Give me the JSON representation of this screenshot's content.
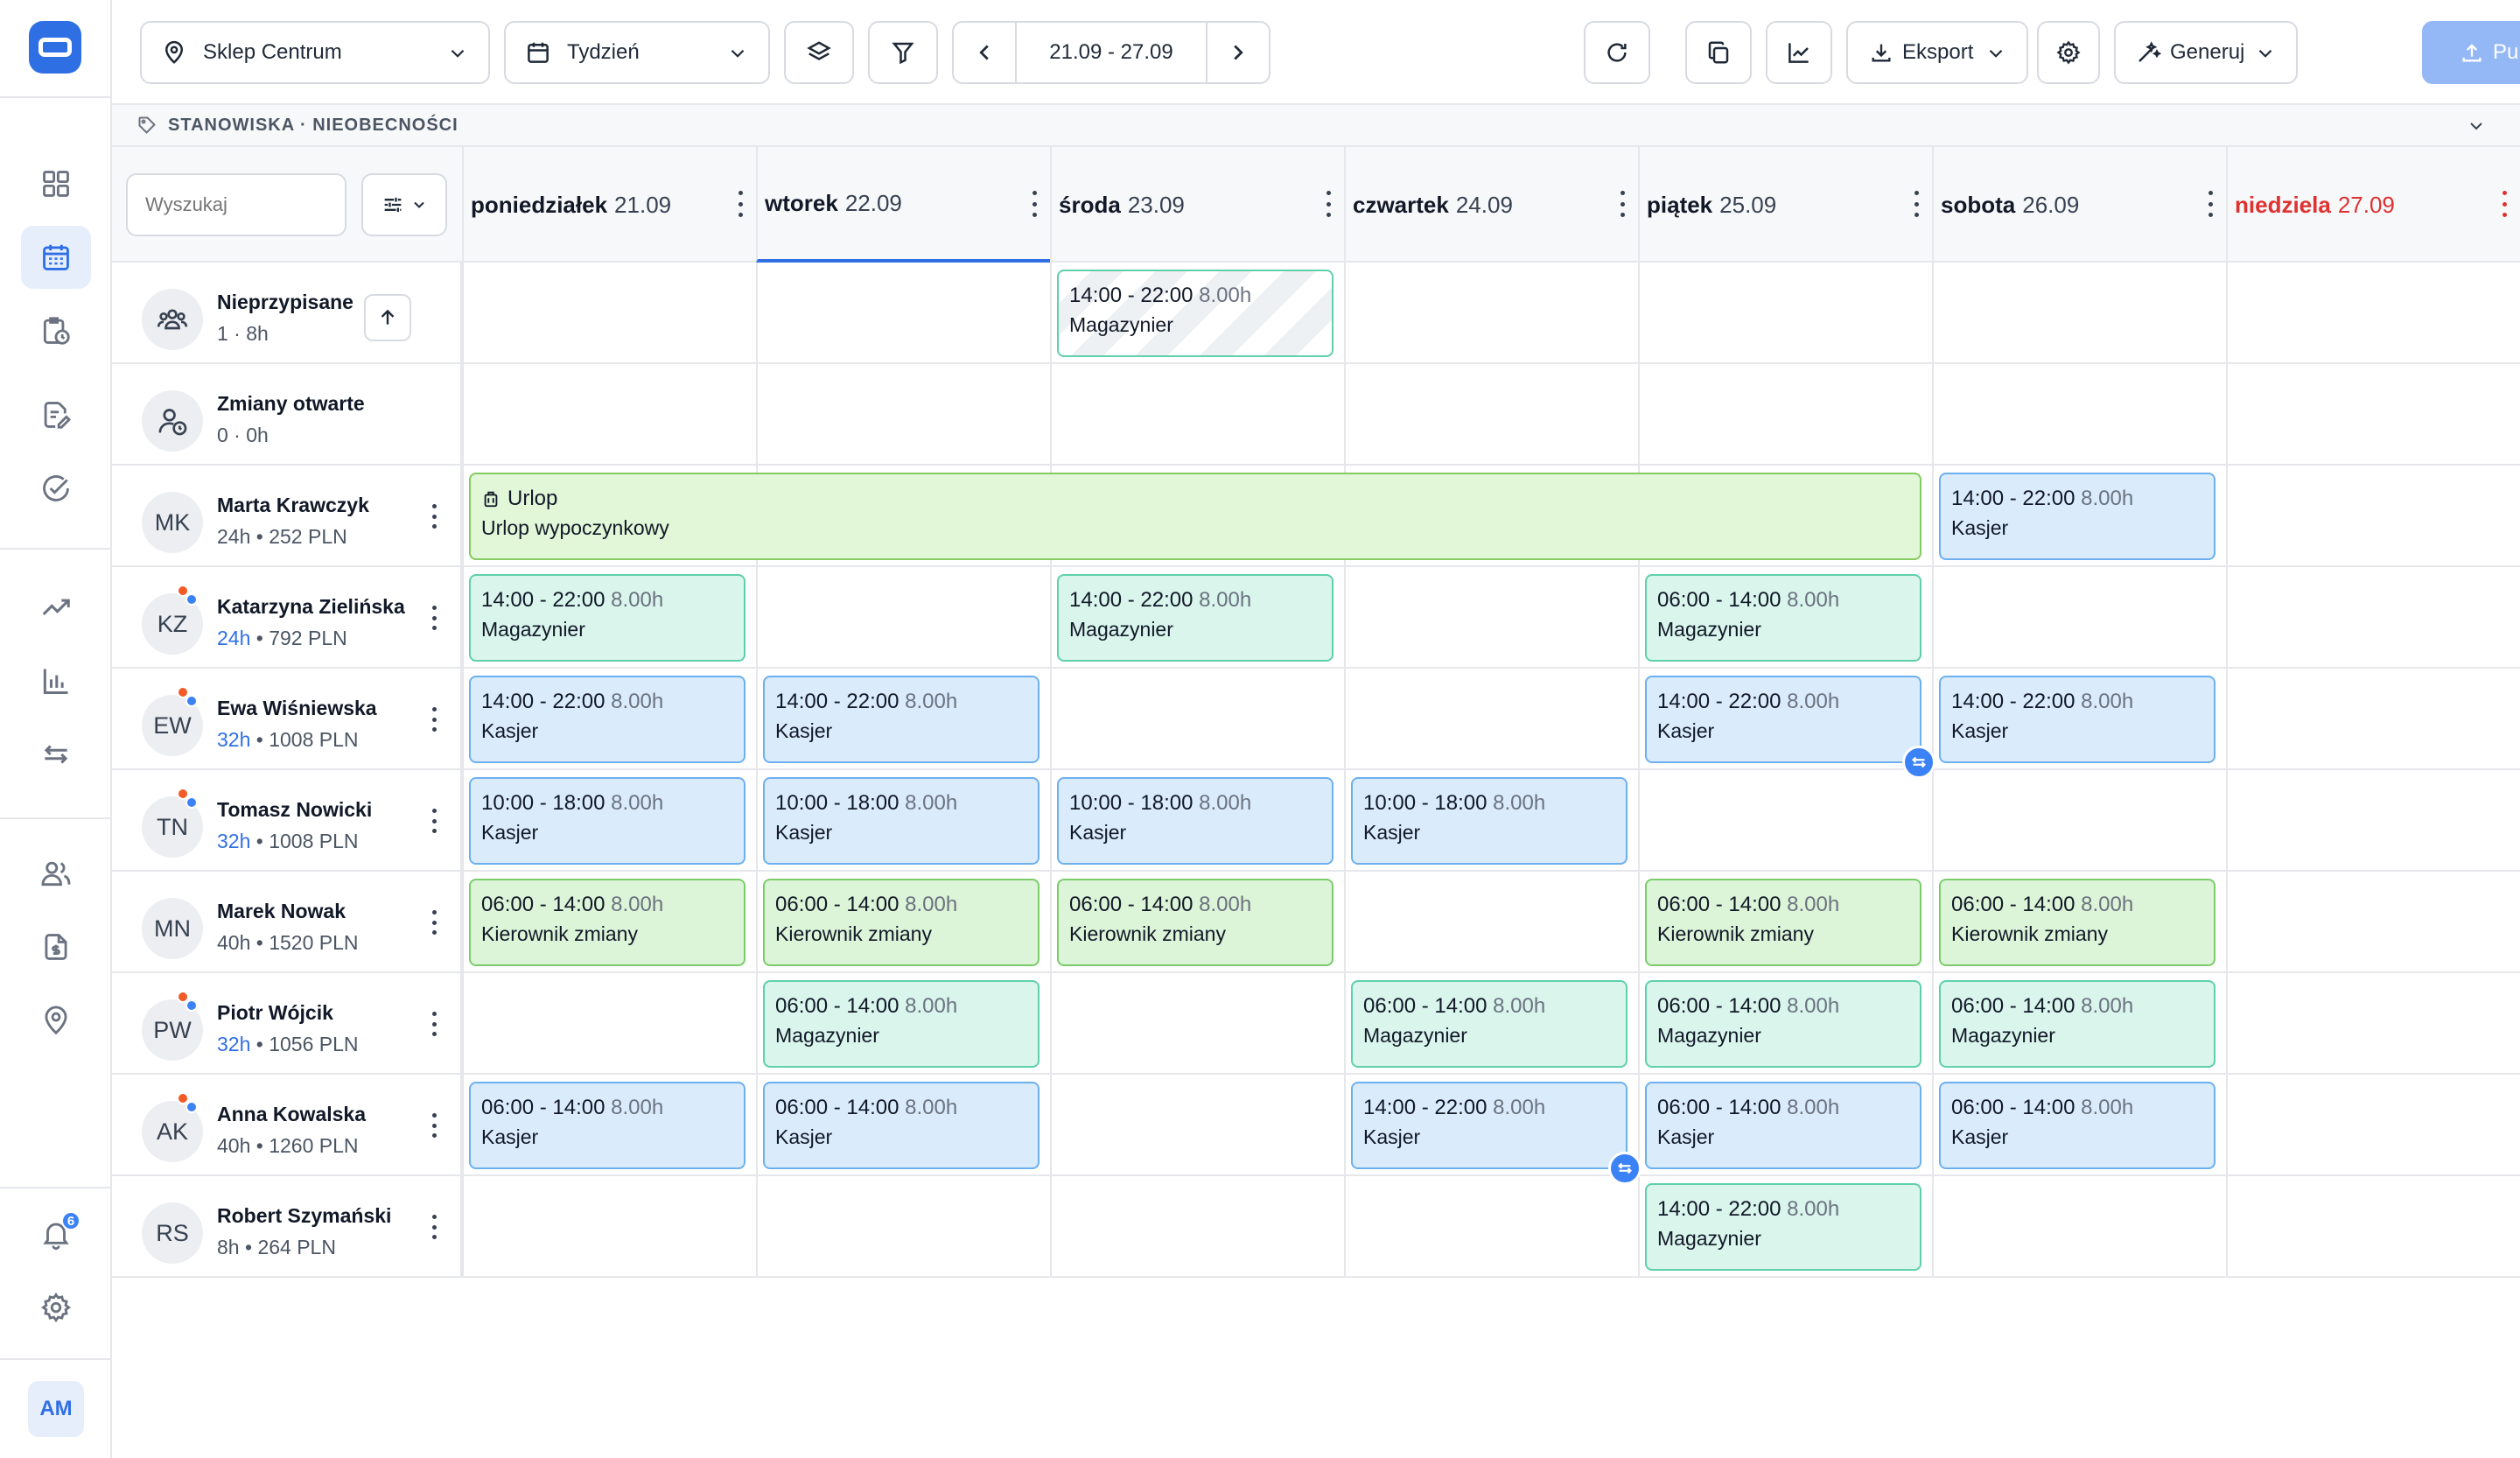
{
  "sidebar": {
    "notification_count": "6",
    "user_initials": "AM"
  },
  "toolbar": {
    "location": "Sklep Centrum",
    "view": "Tydzień",
    "date_range": "21.09 - 27.09",
    "export_label": "Eksport",
    "generate_label": "Generuj",
    "publish_label": "Publikuj"
  },
  "breadcrumb": {
    "text": "STANOWISKA · NIEOBECNOŚCI"
  },
  "grid": {
    "search_placeholder": "Wyszukaj",
    "days": [
      {
        "name": "poniedziałek",
        "date": "21.09"
      },
      {
        "name": "wtorek",
        "date": "22.09"
      },
      {
        "name": "środa",
        "date": "23.09"
      },
      {
        "name": "czwartek",
        "date": "24.09"
      },
      {
        "name": "piątek",
        "date": "25.09"
      },
      {
        "name": "sobota",
        "date": "26.09"
      },
      {
        "name": "niedziela",
        "date": "27.09"
      }
    ],
    "rows": [
      {
        "name": "Nieprzypisane",
        "stats": "1 · 8h"
      },
      {
        "name": "Zmiany otwarte",
        "stats": "0 · 0h"
      },
      {
        "name": "Marta Krawczyk",
        "initials": "MK",
        "hours": "24h",
        "pay": "252 PLN"
      },
      {
        "name": "Katarzyna Zielińska",
        "initials": "KZ",
        "hours": "24h",
        "pay": "792 PLN"
      },
      {
        "name": "Ewa Wiśniewska",
        "initials": "EW",
        "hours": "32h",
        "pay": "1008 PLN"
      },
      {
        "name": "Tomasz Nowicki",
        "initials": "TN",
        "hours": "32h",
        "pay": "1008 PLN"
      },
      {
        "name": "Marek Nowak",
        "initials": "MN",
        "hours": "40h",
        "pay": "1520 PLN"
      },
      {
        "name": "Piotr Wójcik",
        "initials": "PW",
        "hours": "32h",
        "pay": "1056 PLN"
      },
      {
        "name": "Anna Kowalska",
        "initials": "AK",
        "hours": "40h",
        "pay": "1260 PLN"
      },
      {
        "name": "Robert Szymański",
        "initials": "RS",
        "hours": "8h",
        "pay": "264 PLN"
      }
    ],
    "leave": {
      "title": "Urlop",
      "type": "Urlop wypoczynkowy"
    },
    "shifts": [
      {
        "row": 0,
        "day": 2,
        "time": "14:00 - 22:00",
        "dur": "8.00h",
        "role": "Magazynier",
        "kind": "unassigned"
      },
      {
        "row": 2,
        "day": 5,
        "time": "14:00 - 22:00",
        "dur": "8.00h",
        "role": "Kasjer",
        "kind": "kas"
      },
      {
        "row": 3,
        "day": 0,
        "time": "14:00 - 22:00",
        "dur": "8.00h",
        "role": "Magazynier",
        "kind": "mag"
      },
      {
        "row": 3,
        "day": 2,
        "time": "14:00 - 22:00",
        "dur": "8.00h",
        "role": "Magazynier",
        "kind": "mag"
      },
      {
        "row": 3,
        "day": 4,
        "time": "06:00 - 14:00",
        "dur": "8.00h",
        "role": "Magazynier",
        "kind": "mag"
      },
      {
        "row": 4,
        "day": 0,
        "time": "14:00 - 22:00",
        "dur": "8.00h",
        "role": "Kasjer",
        "kind": "kas"
      },
      {
        "row": 4,
        "day": 1,
        "time": "14:00 - 22:00",
        "dur": "8.00h",
        "role": "Kasjer",
        "kind": "kas"
      },
      {
        "row": 4,
        "day": 4,
        "time": "14:00 - 22:00",
        "dur": "8.00h",
        "role": "Kasjer",
        "kind": "kas",
        "swap": true
      },
      {
        "row": 4,
        "day": 5,
        "time": "14:00 - 22:00",
        "dur": "8.00h",
        "role": "Kasjer",
        "kind": "kas"
      },
      {
        "row": 5,
        "day": 0,
        "time": "10:00 - 18:00",
        "dur": "8.00h",
        "role": "Kasjer",
        "kind": "kas"
      },
      {
        "row": 5,
        "day": 1,
        "time": "10:00 - 18:00",
        "dur": "8.00h",
        "role": "Kasjer",
        "kind": "kas"
      },
      {
        "row": 5,
        "day": 2,
        "time": "10:00 - 18:00",
        "dur": "8.00h",
        "role": "Kasjer",
        "kind": "kas"
      },
      {
        "row": 5,
        "day": 3,
        "time": "10:00 - 18:00",
        "dur": "8.00h",
        "role": "Kasjer",
        "kind": "kas"
      },
      {
        "row": 6,
        "day": 0,
        "time": "06:00 - 14:00",
        "dur": "8.00h",
        "role": "Kierownik zmiany",
        "kind": "kier"
      },
      {
        "row": 6,
        "day": 1,
        "time": "06:00 - 14:00",
        "dur": "8.00h",
        "role": "Kierownik zmiany",
        "kind": "kier"
      },
      {
        "row": 6,
        "day": 2,
        "time": "06:00 - 14:00",
        "dur": "8.00h",
        "role": "Kierownik zmiany",
        "kind": "kier"
      },
      {
        "row": 6,
        "day": 4,
        "time": "06:00 - 14:00",
        "dur": "8.00h",
        "role": "Kierownik zmiany",
        "kind": "kier"
      },
      {
        "row": 6,
        "day": 5,
        "time": "06:00 - 14:00",
        "dur": "8.00h",
        "role": "Kierownik zmiany",
        "kind": "kier"
      },
      {
        "row": 7,
        "day": 1,
        "time": "06:00 - 14:00",
        "dur": "8.00h",
        "role": "Magazynier",
        "kind": "mag"
      },
      {
        "row": 7,
        "day": 3,
        "time": "06:00 - 14:00",
        "dur": "8.00h",
        "role": "Magazynier",
        "kind": "mag"
      },
      {
        "row": 7,
        "day": 4,
        "time": "06:00 - 14:00",
        "dur": "8.00h",
        "role": "Magazynier",
        "kind": "mag"
      },
      {
        "row": 7,
        "day": 5,
        "time": "06:00 - 14:00",
        "dur": "8.00h",
        "role": "Magazynier",
        "kind": "mag"
      },
      {
        "row": 8,
        "day": 0,
        "time": "06:00 - 14:00",
        "dur": "8.00h",
        "role": "Kasjer",
        "kind": "kas"
      },
      {
        "row": 8,
        "day": 1,
        "time": "06:00 - 14:00",
        "dur": "8.00h",
        "role": "Kasjer",
        "kind": "kas"
      },
      {
        "row": 8,
        "day": 3,
        "time": "14:00 - 22:00",
        "dur": "8.00h",
        "role": "Kasjer",
        "kind": "kas",
        "swap": true
      },
      {
        "row": 8,
        "day": 4,
        "time": "06:00 - 14:00",
        "dur": "8.00h",
        "role": "Kasjer",
        "kind": "kas"
      },
      {
        "row": 8,
        "day": 5,
        "time": "06:00 - 14:00",
        "dur": "8.00h",
        "role": "Kasjer",
        "kind": "kas"
      },
      {
        "row": 9,
        "day": 4,
        "time": "14:00 - 22:00",
        "dur": "8.00h",
        "role": "Magazynier",
        "kind": "mag"
      }
    ]
  }
}
